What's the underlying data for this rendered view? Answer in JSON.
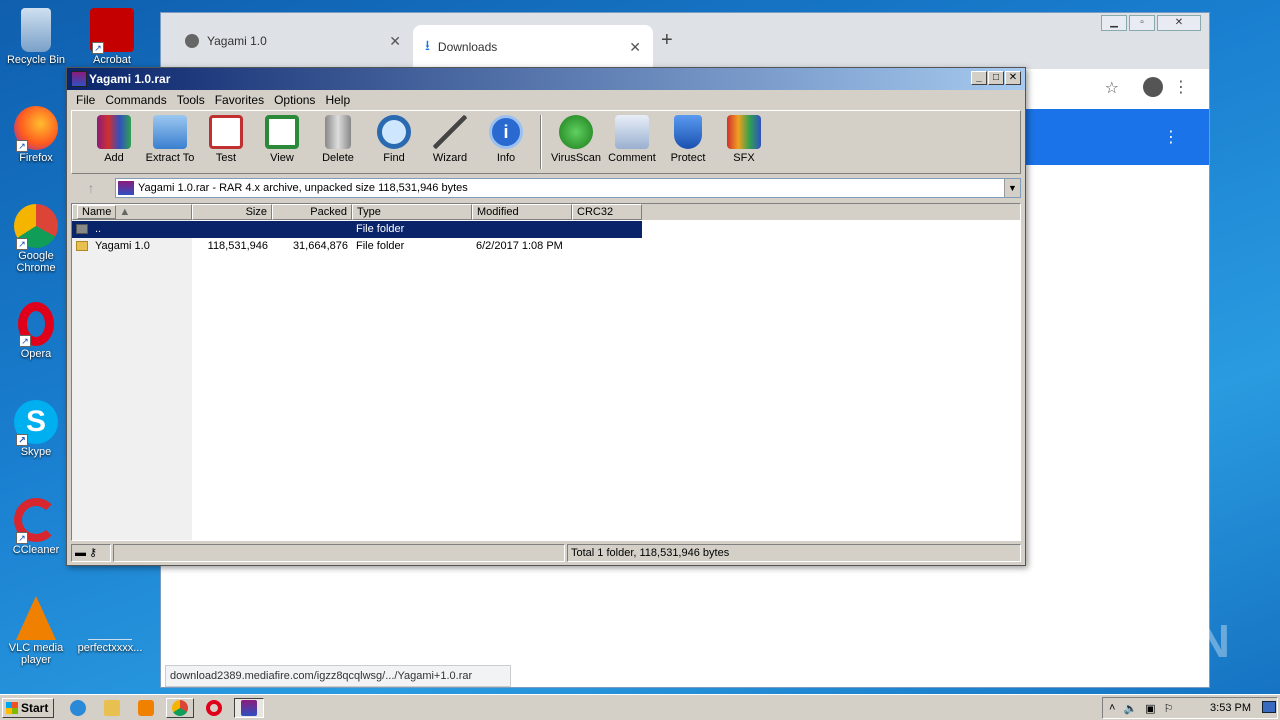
{
  "desktop": {
    "icons": [
      {
        "label": "Recycle Bin"
      },
      {
        "label": "Acrobat"
      },
      {
        "label": "Firefox"
      },
      {
        "label": "Google Chrome"
      },
      {
        "label": "Opera"
      },
      {
        "label": "Skype"
      },
      {
        "label": "CCleaner"
      },
      {
        "label": "VLC media player"
      },
      {
        "label": "perfectxxxx..."
      }
    ]
  },
  "chrome": {
    "tabs": [
      {
        "label": "Yagami 1.0"
      },
      {
        "label": "Downloads"
      }
    ],
    "new_tab": "+",
    "status_url": "download2389.mediafire.com/igzz8qcqlwsg/.../Yagami+1.0.rar"
  },
  "winrar": {
    "title": "Yagami 1.0.rar",
    "menu": [
      "File",
      "Commands",
      "Tools",
      "Favorites",
      "Options",
      "Help"
    ],
    "toolbar": [
      "Add",
      "Extract To",
      "Test",
      "View",
      "Delete",
      "Find",
      "Wizard",
      "Info",
      "VirusScan",
      "Comment",
      "Protect",
      "SFX"
    ],
    "path": "Yagami 1.0.rar - RAR 4.x archive, unpacked size 118,531,946 bytes",
    "columns": [
      "Name",
      "Size",
      "Packed",
      "Type",
      "Modified",
      "CRC32"
    ],
    "rows": [
      {
        "name": "..",
        "size": "",
        "packed": "",
        "type": "File folder",
        "modified": "",
        "crc": ""
      },
      {
        "name": "Yagami 1.0",
        "size": "118,531,946",
        "packed": "31,664,876",
        "type": "File folder",
        "modified": "6/2/2017 1:08 PM",
        "crc": ""
      }
    ],
    "status_total": "Total 1 folder, 118,531,946 bytes"
  },
  "taskbar": {
    "start": "Start",
    "clock": "3:53 PM"
  },
  "watermark": "ANY RUN"
}
